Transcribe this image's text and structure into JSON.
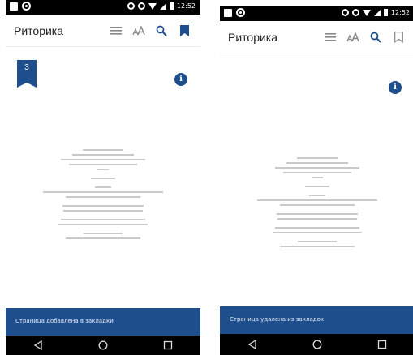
{
  "screens": [
    {
      "status": {
        "time": "12:52"
      },
      "app_title": "Риторика",
      "bookmark": {
        "active": true,
        "page_number": "3",
        "color": "#1f4e8c"
      },
      "snackbar": {
        "message": "Страница добавлена в закладки"
      }
    },
    {
      "status": {
        "time": "12:52"
      },
      "app_title": "Риторика",
      "bookmark": {
        "active": false
      },
      "snackbar": {
        "message": "Страница удалена из закладок"
      }
    }
  ],
  "icons": {
    "toc": "list-icon",
    "font": "text-size-icon",
    "search": "search-icon",
    "bookmark": "bookmark-icon",
    "info": "info-icon",
    "back": "back-icon",
    "home": "home-icon",
    "recents": "recents-icon"
  },
  "colors": {
    "accent": "#1f4e8c",
    "statusbar": "#000000"
  }
}
